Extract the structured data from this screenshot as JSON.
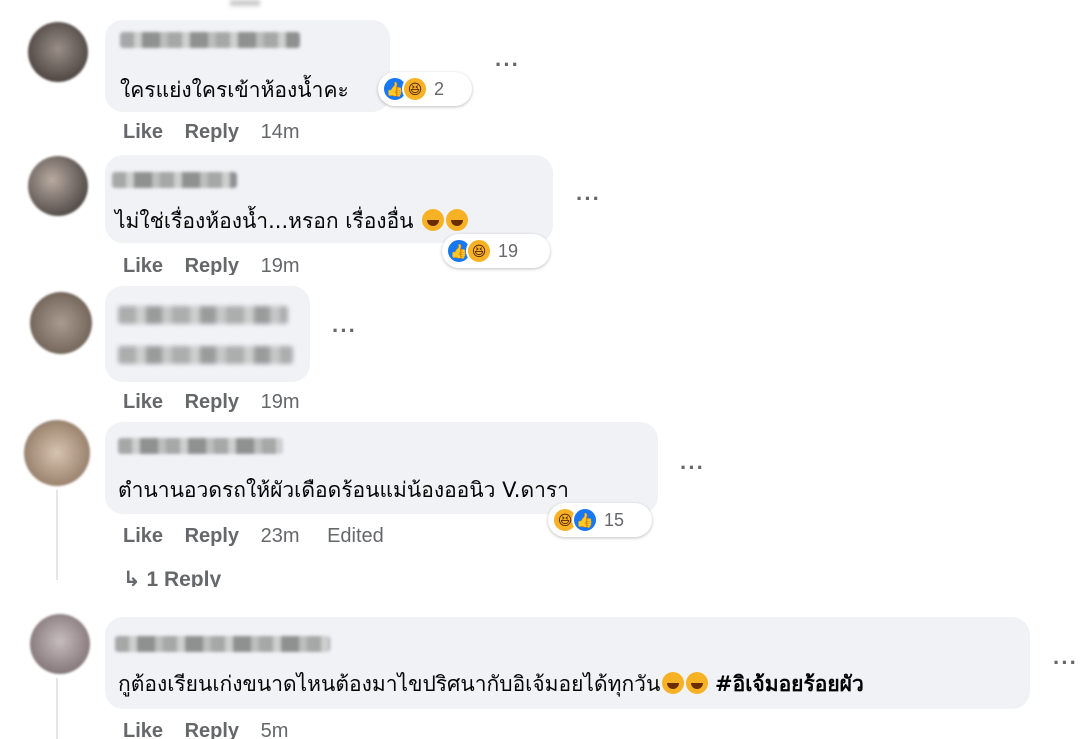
{
  "comments": [
    {
      "text": "ใครแย่งใครเข้าห้องน้ำคะ",
      "reaction_count": "2",
      "reactions": [
        "like-icon",
        "haha-icon"
      ],
      "actions": {
        "like": "Like",
        "reply": "Reply",
        "time": "14m"
      }
    },
    {
      "text": "ไม่ใช่เรื่องห้องน้ำ...หรอก เรื่องอื่น",
      "reaction_count": "19",
      "reactions": [
        "like-icon",
        "haha-icon"
      ],
      "actions": {
        "like": "Like",
        "reply": "Reply",
        "time": "19m"
      }
    },
    {
      "text": "",
      "actions": {
        "like": "Like",
        "reply": "Reply",
        "time": "19m"
      }
    },
    {
      "text": "ตำนานอวดรถให้ผัวเดือดร้อนแม่น้องออนิว V.ดารา",
      "reaction_count": "15",
      "reactions": [
        "haha-icon",
        "like-icon"
      ],
      "actions": {
        "like": "Like",
        "reply": "Reply",
        "time": "23m",
        "edited": "Edited"
      },
      "replies_link": "1 Reply"
    },
    {
      "text": "กูต้องเรียนเก่งขนาดไหนต้องมาไขปริศนากับอิเจ้มอยได้ทุกวัน",
      "hashtag": "#อิเจ้มอยร้อยผัว",
      "actions": {
        "like": "Like",
        "reply": "Reply",
        "time": "5m"
      }
    }
  ],
  "more_label": "···",
  "colors": {
    "bubble": "#f0f2f5",
    "muted": "#65676b",
    "like_blue": "#1877f2",
    "haha_yellow": "#f7b125"
  }
}
